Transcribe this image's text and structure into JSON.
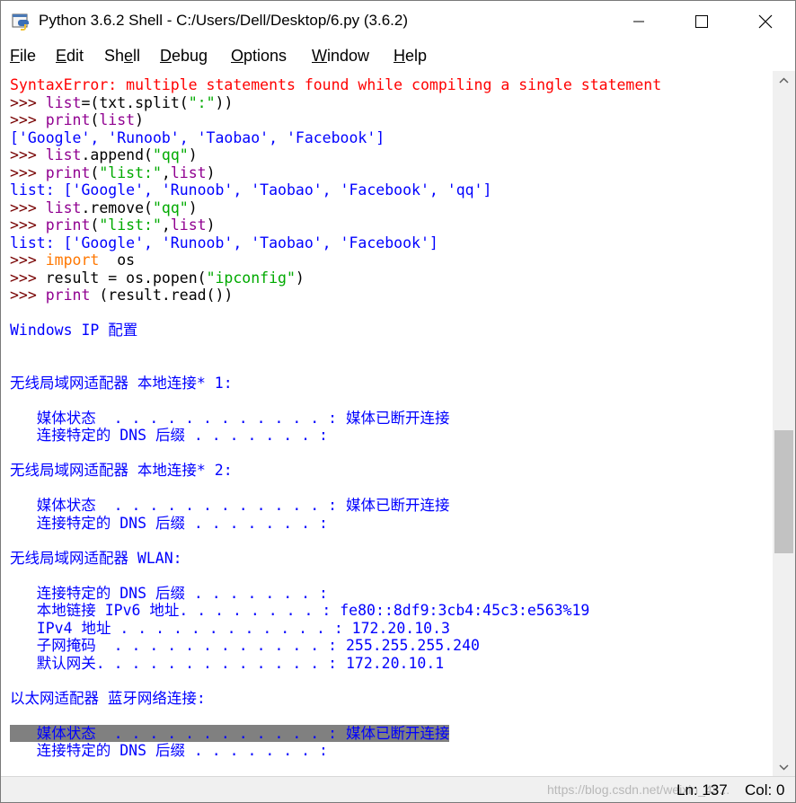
{
  "window": {
    "title": "Python 3.6.2 Shell - C:/Users/Dell/Desktop/6.py (3.6.2)"
  },
  "menu": [
    "File",
    "Edit",
    "Shell",
    "Debug",
    "Options",
    "Window",
    "Help"
  ],
  "menu_mnemonics": [
    "F",
    "E",
    "e",
    "D",
    "O",
    "W",
    "H"
  ],
  "shell_lines": [
    [
      {
        "t": "SyntaxError: multiple statements found while compiling a single statement",
        "c": "err"
      }
    ],
    [
      {
        "t": ">>> ",
        "c": "prompt"
      },
      {
        "t": "list",
        "c": "bi"
      },
      {
        "t": "=(txt.split(",
        "c": "code"
      },
      {
        "t": "\":\"",
        "c": "str"
      },
      {
        "t": "))",
        "c": "code"
      }
    ],
    [
      {
        "t": ">>> ",
        "c": "prompt"
      },
      {
        "t": "print",
        "c": "bi"
      },
      {
        "t": "(",
        "c": "code"
      },
      {
        "t": "list",
        "c": "bi"
      },
      {
        "t": ")",
        "c": "code"
      }
    ],
    [
      {
        "t": "['Google', 'Runoob', 'Taobao', 'Facebook']",
        "c": "out"
      }
    ],
    [
      {
        "t": ">>> ",
        "c": "prompt"
      },
      {
        "t": "list",
        "c": "bi"
      },
      {
        "t": ".append(",
        "c": "code"
      },
      {
        "t": "\"qq\"",
        "c": "str"
      },
      {
        "t": ")",
        "c": "code"
      }
    ],
    [
      {
        "t": ">>> ",
        "c": "prompt"
      },
      {
        "t": "print",
        "c": "bi"
      },
      {
        "t": "(",
        "c": "code"
      },
      {
        "t": "\"list:\"",
        "c": "str"
      },
      {
        "t": ",",
        "c": "code"
      },
      {
        "t": "list",
        "c": "bi"
      },
      {
        "t": ")",
        "c": "code"
      }
    ],
    [
      {
        "t": "list: ['Google', 'Runoob', 'Taobao', 'Facebook', 'qq']",
        "c": "out"
      }
    ],
    [
      {
        "t": ">>> ",
        "c": "prompt"
      },
      {
        "t": "list",
        "c": "bi"
      },
      {
        "t": ".remove(",
        "c": "code"
      },
      {
        "t": "\"qq\"",
        "c": "str"
      },
      {
        "t": ")",
        "c": "code"
      }
    ],
    [
      {
        "t": ">>> ",
        "c": "prompt"
      },
      {
        "t": "print",
        "c": "bi"
      },
      {
        "t": "(",
        "c": "code"
      },
      {
        "t": "\"list:\"",
        "c": "str"
      },
      {
        "t": ",",
        "c": "code"
      },
      {
        "t": "list",
        "c": "bi"
      },
      {
        "t": ")",
        "c": "code"
      }
    ],
    [
      {
        "t": "list: ['Google', 'Runoob', 'Taobao', 'Facebook']",
        "c": "out"
      }
    ],
    [
      {
        "t": ">>> ",
        "c": "prompt"
      },
      {
        "t": "import",
        "c": "kw"
      },
      {
        "t": "  os",
        "c": "code"
      }
    ],
    [
      {
        "t": ">>> ",
        "c": "prompt"
      },
      {
        "t": "result = os.popen(",
        "c": "code"
      },
      {
        "t": "\"ipconfig\"",
        "c": "str"
      },
      {
        "t": ")",
        "c": "code"
      }
    ],
    [
      {
        "t": ">>> ",
        "c": "prompt"
      },
      {
        "t": "print",
        "c": "bi"
      },
      {
        "t": " (result.read())",
        "c": "code"
      }
    ],
    [],
    [
      {
        "t": "Windows IP 配置",
        "c": "out"
      }
    ],
    [],
    [],
    [
      {
        "t": "无线局域网适配器 本地连接* 1:",
        "c": "out"
      }
    ],
    [],
    [
      {
        "t": "   媒体状态  . . . . . . . . . . . . : 媒体已断开连接",
        "c": "out"
      }
    ],
    [
      {
        "t": "   连接特定的 DNS 后缀 . . . . . . . :",
        "c": "out"
      }
    ],
    [],
    [
      {
        "t": "无线局域网适配器 本地连接* 2:",
        "c": "out"
      }
    ],
    [],
    [
      {
        "t": "   媒体状态  . . . . . . . . . . . . : 媒体已断开连接",
        "c": "out"
      }
    ],
    [
      {
        "t": "   连接特定的 DNS 后缀 . . . . . . . :",
        "c": "out"
      }
    ],
    [],
    [
      {
        "t": "无线局域网适配器 WLAN:",
        "c": "out"
      }
    ],
    [],
    [
      {
        "t": "   连接特定的 DNS 后缀 . . . . . . . :",
        "c": "out"
      }
    ],
    [
      {
        "t": "   本地链接 IPv6 地址. . . . . . . . : fe80::8df9:3cb4:45c3:e563%19",
        "c": "out"
      }
    ],
    [
      {
        "t": "   IPv4 地址 . . . . . . . . . . . . : 172.20.10.3",
        "c": "out"
      }
    ],
    [
      {
        "t": "   子网掩码  . . . . . . . . . . . . : 255.255.255.240",
        "c": "out"
      }
    ],
    [
      {
        "t": "   默认网关. . . . . . . . . . . . . : 172.20.10.1",
        "c": "out"
      }
    ],
    [],
    [
      {
        "t": "以太网适配器 蓝牙网络连接:",
        "c": "out"
      }
    ],
    [],
    [
      {
        "t": "   媒体状态  . . . . . . . . . . . . : 媒体已断开连接",
        "c": "out hl"
      }
    ],
    [
      {
        "t": "   连接特定的 DNS 后缀 . . . . . . . :",
        "c": "out"
      }
    ]
  ],
  "status": {
    "ln": "Ln: 137",
    "col": "Col: 0",
    "watermark": "https://blog.csdn.net/weixin_43..."
  },
  "colors": {
    "prompt": "#770000",
    "keyword": "#ff7700",
    "builtin": "#900090",
    "string": "#00aa00",
    "stdout": "#0000ff",
    "error": "#ff0000"
  },
  "icons": {
    "app": "python-idle-icon",
    "minimize": "minimize-icon",
    "maximize": "maximize-icon",
    "close": "close-icon",
    "scroll_up": "chevron-up-icon",
    "scroll_down": "chevron-down-icon"
  }
}
